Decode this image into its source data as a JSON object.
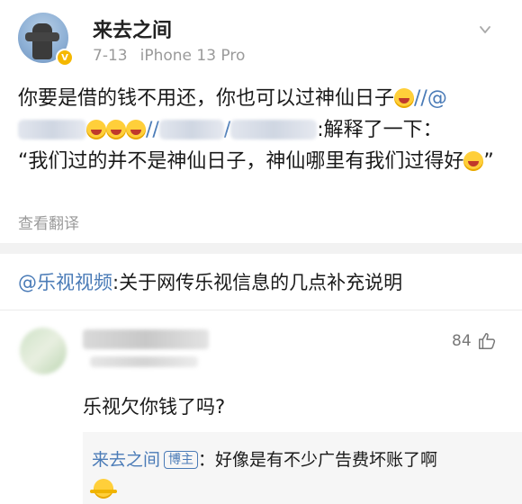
{
  "post": {
    "username": "来去之间",
    "verified_badge": "V",
    "date": "7-13",
    "device": "iPhone 13 Pro",
    "text_part1": "你要是借的钱不用还，你也可以过神仙日子",
    "sep1": "//@",
    "sep2": "//",
    "sep3": "/",
    "text_part2": ":解释了一下：",
    "text_part3": "“我们过的并不是神仙日子，神仙哪里有我们过得好",
    "text_part4": "”",
    "translate_label": "查看翻译"
  },
  "linked_article": {
    "mention": "@乐视视频",
    "text": ":关于网传乐视信息的几点补充说明"
  },
  "comment": {
    "likes": "84",
    "text": "乐视欠你钱了吗?",
    "reply": {
      "author": "来去之间",
      "author_badge": "博主",
      "text": "：好像是有不少广告费坏账了啊"
    }
  },
  "icons": {
    "emoji": "laugh-cry-emoji",
    "like": "thumbs-up-icon",
    "more": "chevron-down-icon",
    "shrug": "shrug-emoji"
  }
}
